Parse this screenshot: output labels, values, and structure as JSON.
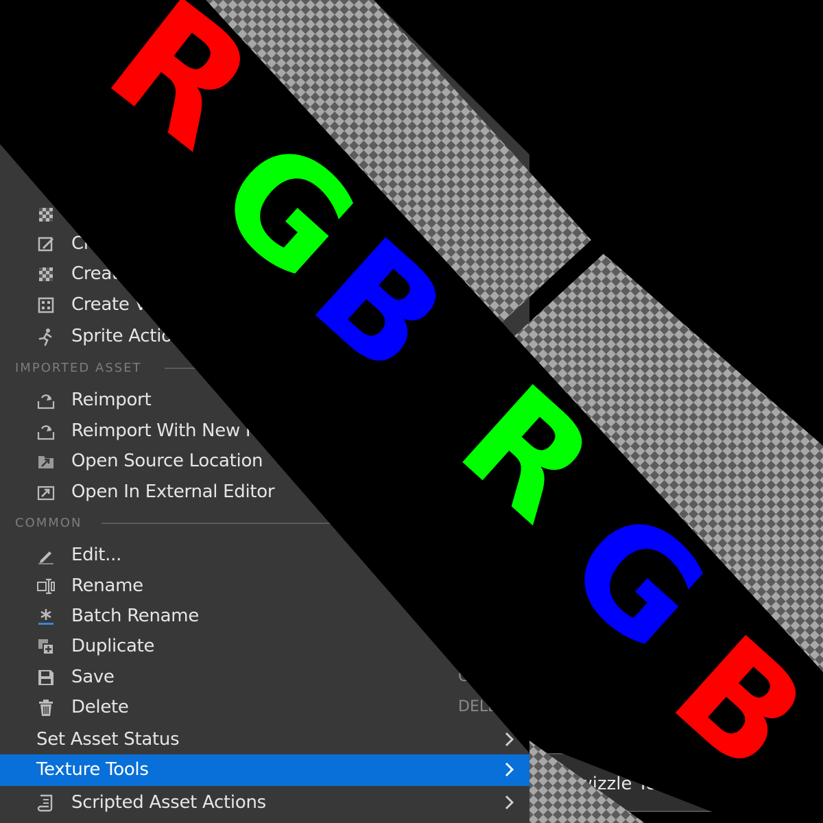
{
  "menu": {
    "items": [
      {
        "name": "create-item-1",
        "icon": "checker-texture-icon",
        "label": ""
      },
      {
        "name": "create-item-2",
        "icon": "create-asset-icon",
        "label": "Cr"
      },
      {
        "name": "create-item-3",
        "icon": "checker-texture-icon",
        "label": "Create"
      },
      {
        "name": "create-item-4",
        "icon": "volume-texture-icon",
        "label": "Create Vo"
      },
      {
        "name": "sprite-actions",
        "icon": "sprite-run-icon",
        "label": "Sprite Action"
      }
    ],
    "sections": {
      "imported_asset": "IMPORTED ASSET",
      "common": "COMMON"
    },
    "imported_items": [
      {
        "name": "reimport",
        "icon": "reimport-icon",
        "label": "Reimport"
      },
      {
        "name": "reimport-new-file",
        "icon": "reimport-icon",
        "label": "Reimport With New File"
      },
      {
        "name": "open-source-location",
        "icon": "open-folder-icon",
        "label": "Open Source Location"
      },
      {
        "name": "open-external-editor",
        "icon": "open-external-icon",
        "label": "Open In External Editor"
      }
    ],
    "common_items": [
      {
        "name": "edit",
        "icon": "pencil-icon",
        "label": "Edit..."
      },
      {
        "name": "rename",
        "icon": "rename-icon",
        "label": "Rename"
      },
      {
        "name": "batch-rename",
        "icon": "asterisk-icon",
        "label": "Batch Rename"
      },
      {
        "name": "duplicate",
        "icon": "duplicate-icon",
        "label": "Duplicate"
      },
      {
        "name": "save",
        "icon": "save-icon",
        "label": "Save",
        "shortcut": "CTR"
      },
      {
        "name": "delete",
        "icon": "trash-icon",
        "label": "Delete",
        "shortcut": "DELETE"
      }
    ],
    "submenus": [
      {
        "name": "set-asset-status",
        "label": "Set Asset Status"
      },
      {
        "name": "texture-tools",
        "label": "Texture Tools",
        "selected": true
      },
      {
        "name": "scripted-asset-actions",
        "icon": "script-icon",
        "label": "Scripted Asset Actions"
      }
    ]
  },
  "submenu": {
    "label": "Swizzle Texture Channels..."
  },
  "overlay": {
    "letters": [
      "R",
      "G",
      "B",
      "R",
      "G",
      "B"
    ],
    "colors": [
      "#ff0000",
      "#00ff00",
      "#0000ff",
      "#00ff00",
      "#0000ff",
      "#ff0000"
    ]
  },
  "colors": {
    "menu_bg": "#383838",
    "selected": "#0870d8",
    "text": "#e6e6e6",
    "section_text": "#7d7d7d"
  }
}
